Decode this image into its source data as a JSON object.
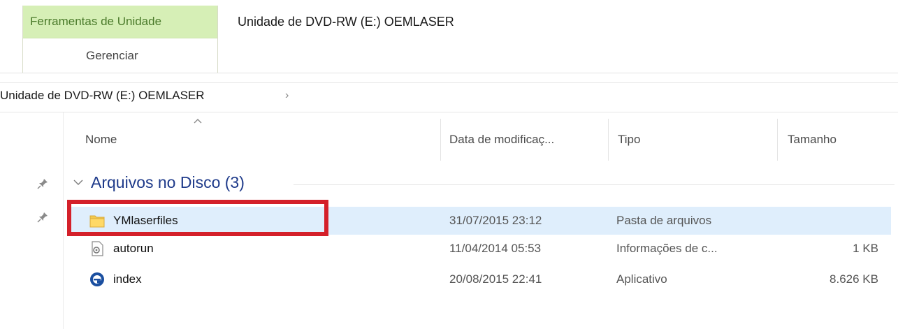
{
  "ribbon": {
    "context_tab_header": "Ferramentas de Unidade",
    "context_tab_label": "Gerenciar",
    "window_title": "Unidade de DVD-RW (E:) OEMLASER"
  },
  "address_bar": {
    "path": "Unidade de DVD-RW (E:) OEMLASER",
    "chevron": "›"
  },
  "columns": {
    "name": "Nome",
    "date": "Data de modificaç...",
    "type": "Tipo",
    "size": "Tamanho"
  },
  "group": {
    "title": "Arquivos no Disco (3)"
  },
  "files": [
    {
      "name": "YMlaserfiles",
      "date": "31/07/2015 23:12",
      "type": "Pasta de arquivos",
      "size": "",
      "icon": "folder-icon",
      "selected": true
    },
    {
      "name": "autorun",
      "date": "11/04/2014 05:53",
      "type": "Informações de c...",
      "size": "1 KB",
      "icon": "settings-file-icon",
      "selected": false
    },
    {
      "name": "index",
      "date": "20/08/2015 22:41",
      "type": "Aplicativo",
      "size": "8.626 KB",
      "icon": "internet-explorer-icon",
      "selected": false
    }
  ],
  "colors": {
    "context_tab_bg": "#d6efb6",
    "selection_bg": "#dfeefc",
    "highlight_border": "#d4202a",
    "group_title": "#1e3a8a"
  }
}
